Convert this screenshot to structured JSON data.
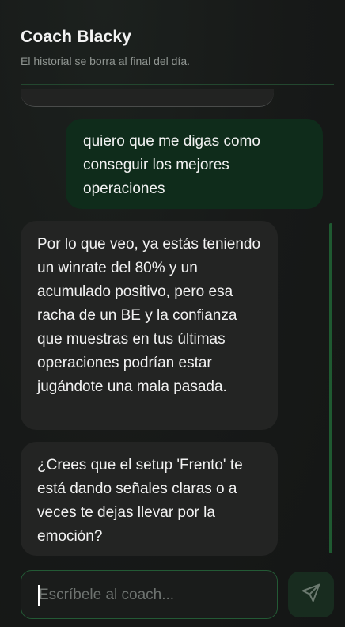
{
  "header": {
    "title": "Coach Blacky",
    "subtitle": "El historial se borra al final del día."
  },
  "messages": [
    {
      "role": "user",
      "text": "quiero que me digas como conseguir los mejores operaciones"
    },
    {
      "role": "assistant",
      "text": "Por lo que veo, ya estás teniendo un winrate del 80% y un acumulado positivo, pero esa racha de un BE y la confianza que muestras en tus últimas operaciones podrían estar jugándote una mala pasada."
    },
    {
      "role": "assistant",
      "text": "¿Crees que el setup 'Frento' te está dando señales claras o a veces te dejas llevar por la emoción?"
    }
  ],
  "composer": {
    "placeholder": "Escríbele al coach...",
    "value": ""
  },
  "send_button": {
    "icon": "send-icon"
  },
  "colors": {
    "accent": "#235a35",
    "user_bubble": "#0f2c1b",
    "assistant_bubble": "#232423",
    "background": "#181a19"
  }
}
